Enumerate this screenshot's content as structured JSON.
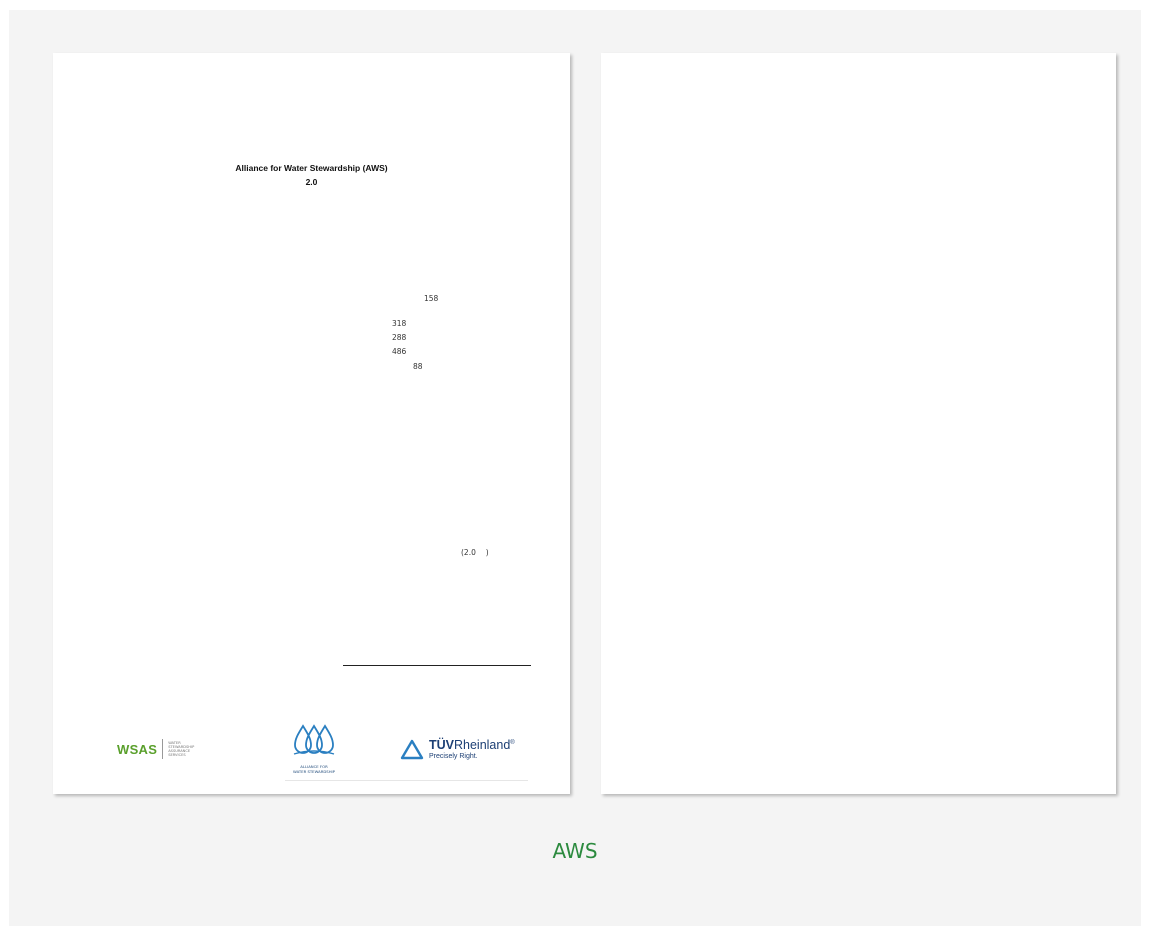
{
  "document": {
    "title": "Alliance for Water Stewardship (AWS)",
    "version": "2.0",
    "stats": [
      "158",
      "318",
      "288",
      "486",
      "88"
    ],
    "version_note": "(2.0 　)"
  },
  "logos": {
    "wsas": {
      "name": "WSAS",
      "subtitle_lines": [
        "WATER",
        "STEWARDSHIP",
        "ASSURANCE",
        "SERVICES"
      ]
    },
    "aws": {
      "subtitle_lines": [
        "ALLIANCE FOR",
        "WATER STEWARDSHIP"
      ]
    },
    "tuv": {
      "brand_bold": "TÜV",
      "brand_rest": "Rheinland",
      "registered": "®",
      "tagline": "Precisely Right."
    }
  },
  "caption": "AWS",
  "colors": {
    "viewer_bg": "#f4f4f4",
    "caption": "#2b8a3e",
    "wsas_green": "#5aa02c",
    "aws_blue": "#2a7fc1",
    "tuv_blue": "#1c3f74"
  }
}
